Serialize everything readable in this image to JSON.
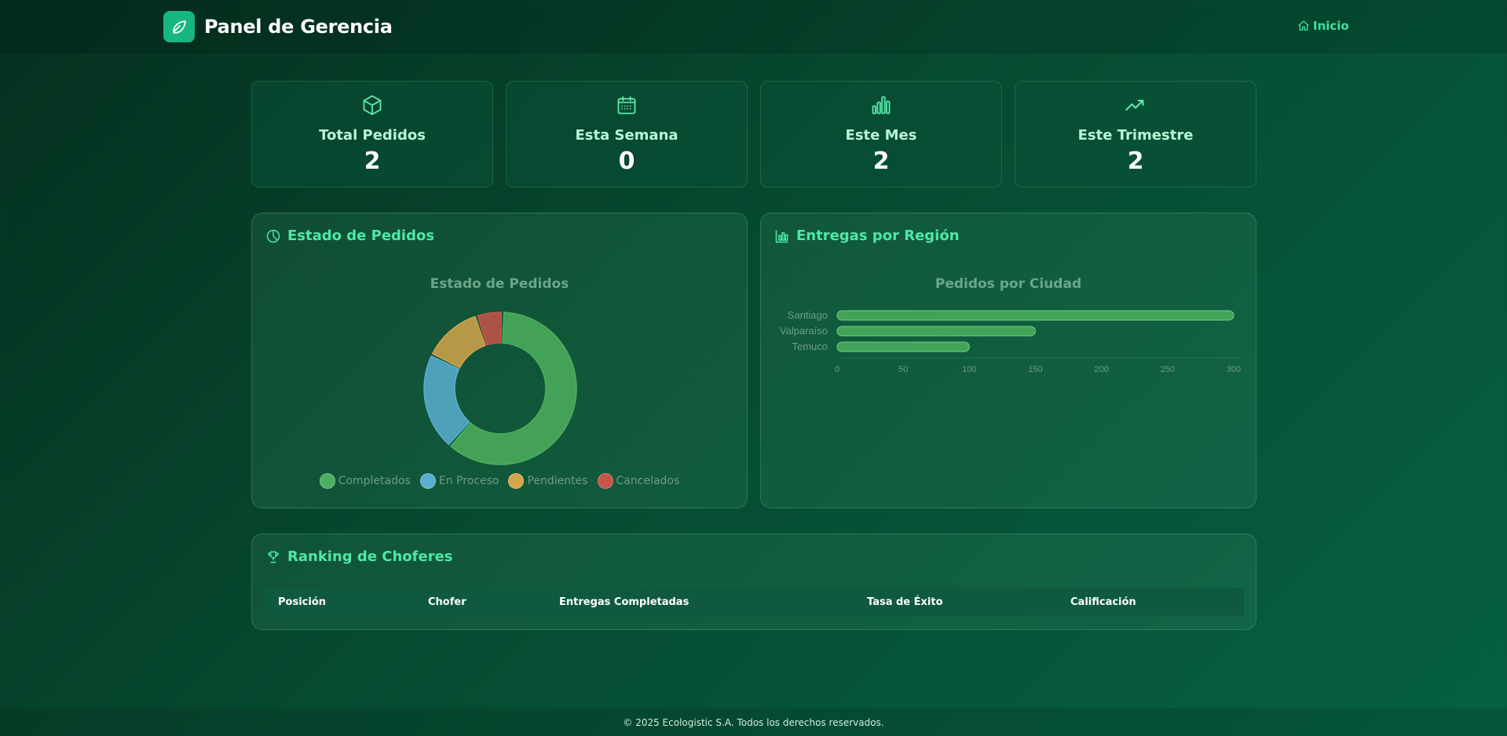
{
  "header": {
    "title": "Panel de Gerencia",
    "logo_icon": "leaf-icon",
    "nav_home": "Inicio"
  },
  "stats": [
    {
      "icon": "box-icon",
      "label": "Total Pedidos",
      "value": "2"
    },
    {
      "icon": "calendar-icon",
      "label": "Esta Semana",
      "value": "0"
    },
    {
      "icon": "bar-chart-icon",
      "label": "Este Mes",
      "value": "2"
    },
    {
      "icon": "trending-up-icon",
      "label": "Este Trimestre",
      "value": "2"
    }
  ],
  "order_status_panel": {
    "title": "Estado de Pedidos",
    "icon": "pie-chart-icon"
  },
  "region_panel": {
    "title": "Entregas por Región",
    "icon": "bar-chart-icon"
  },
  "ranking_panel": {
    "title": "Ranking de Choferes",
    "icon": "trophy-icon",
    "columns": [
      "Posición",
      "Chofer",
      "Entregas Completadas",
      "Tasa de Éxito",
      "Calificación"
    ]
  },
  "chart_data": [
    {
      "type": "pie",
      "title": "Estado de Pedidos",
      "categories": [
        "Completados",
        "En Proceso",
        "Pendientes",
        "Cancelados"
      ],
      "values": [
        60,
        20,
        12,
        5
      ],
      "colors": [
        "#4caf5e",
        "#5aaed0",
        "#d4a54a",
        "#c8534a"
      ],
      "legend": "bottom",
      "doughnut": true
    },
    {
      "type": "bar",
      "orientation": "horizontal",
      "title": "Pedidos por Ciudad",
      "categories": [
        "Santiago",
        "Valparaíso",
        "Temuco"
      ],
      "values": [
        300,
        150,
        100
      ],
      "xlim": [
        0,
        300
      ],
      "xticks": [
        "0",
        "50",
        "100",
        "150",
        "200",
        "250",
        "300"
      ],
      "color": "#4caf5e",
      "grid": false
    }
  ],
  "footer": {
    "text": "© 2025 Ecologistic S.A. Todos los derechos reservados."
  }
}
